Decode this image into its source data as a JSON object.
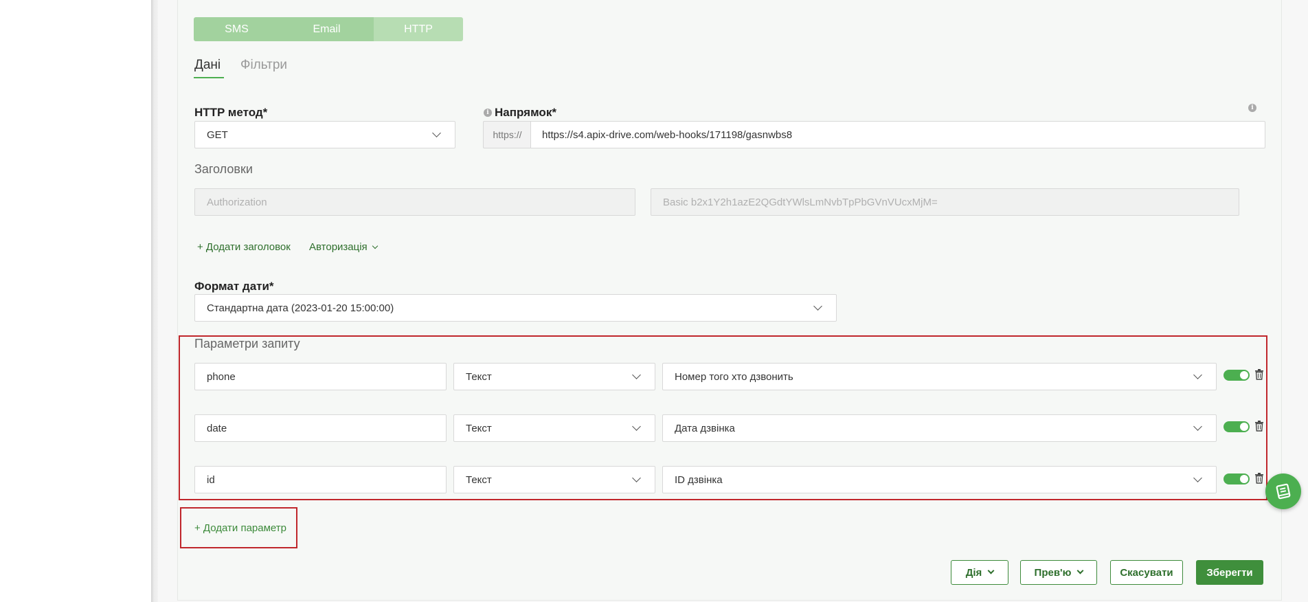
{
  "type_tabs": [
    "SMS",
    "Email",
    "HTTP"
  ],
  "sub_tabs": {
    "data": "Дані",
    "filters": "Фільтри"
  },
  "http_method": {
    "label": "HTTP метод*",
    "value": "GET"
  },
  "direction": {
    "label": "Напрямок*",
    "prefix": "https://",
    "value": "https://s4.apix-drive.com/web-hooks/171198/gasnwbs8"
  },
  "headers": {
    "title": "Заголовки",
    "name_placeholder": "Authorization",
    "value_placeholder": "Basic b2x1Y2h1azE2QGdtYWlsLmNvbTpPbGVnVUcxMjM="
  },
  "add_header_label": "+ Додати заголовок",
  "auth_label": "Авторизація",
  "date_format": {
    "label": "Формат дати*",
    "value": "Стандартна дата (2023-01-20 15:00:00)"
  },
  "query_params": {
    "title": "Параметри запиту",
    "rows": [
      {
        "name": "phone",
        "type": "Текст",
        "value": "Номер того хто дзвонить",
        "enabled": true
      },
      {
        "name": "date",
        "type": "Текст",
        "value": "Дата дзвінка",
        "enabled": true
      },
      {
        "name": "id",
        "type": "Текст",
        "value": "ID дзвінка",
        "enabled": true
      }
    ]
  },
  "add_param_label": "+ Додати параметр",
  "footer": {
    "action": "Дія",
    "preview": "Прев'ю",
    "cancel": "Скасувати",
    "save": "Зберегти"
  },
  "colors": {
    "accent": "#4caf50",
    "accent_dark": "#3f8f3c",
    "highlight_border": "#c0262b"
  }
}
